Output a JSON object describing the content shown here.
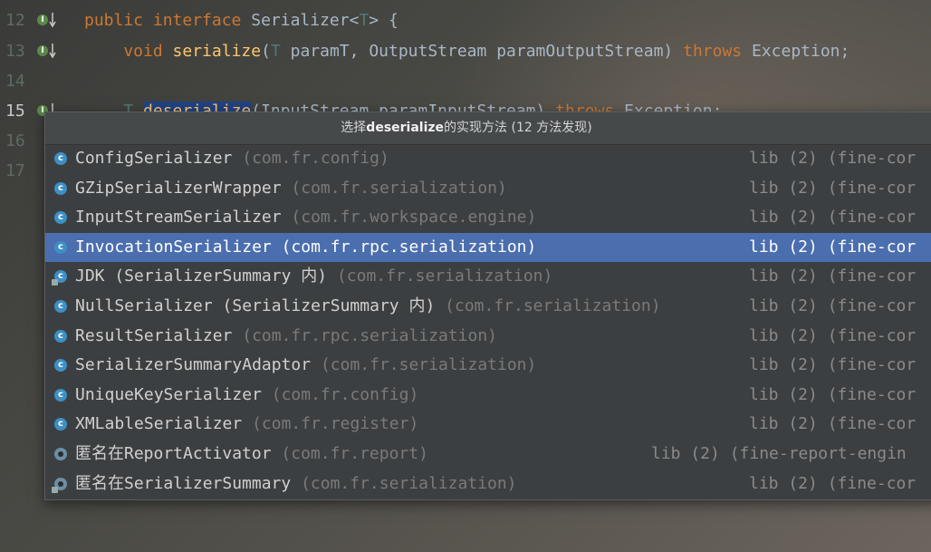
{
  "editor": {
    "lines": [
      {
        "number": "12",
        "code_parts": [
          {
            "t": "public ",
            "c": "kw"
          },
          {
            "t": "interface ",
            "c": "kw"
          },
          {
            "t": "Serializer<",
            "c": ""
          },
          {
            "t": "T",
            "c": "tp"
          },
          {
            "t": "> {",
            "c": ""
          }
        ]
      },
      {
        "number": "13",
        "code_parts": [
          {
            "t": "    void ",
            "c": "kw"
          },
          {
            "t": "serialize",
            "c": "fn"
          },
          {
            "t": "(",
            "c": ""
          },
          {
            "t": "T",
            "c": "tp"
          },
          {
            "t": " paramT, OutputStream paramOutputStream) ",
            "c": ""
          },
          {
            "t": "throws ",
            "c": "kw"
          },
          {
            "t": "Exception;",
            "c": ""
          }
        ]
      },
      {
        "number": "14",
        "code_parts": []
      },
      {
        "number": "15",
        "code_parts": [
          {
            "t": "    T ",
            "c": "tp"
          },
          {
            "t": "deserialize",
            "c": "fn hl"
          },
          {
            "t": "(InputStream paramInputStream) ",
            "c": ""
          },
          {
            "t": "throws ",
            "c": "kw"
          },
          {
            "t": "Exception;",
            "c": ""
          }
        ]
      },
      {
        "number": "16",
        "code_parts": []
      },
      {
        "number": "17",
        "code_parts": []
      }
    ]
  },
  "popup": {
    "title_prefix": "选择",
    "title_method": "deserialize",
    "title_suffix": "的实现方法 (12 方法发现)",
    "items": [
      {
        "name": "ConfigSerializer",
        "pkg": "(com.fr.config)",
        "lib": "lib (2) (fine-cor",
        "icon": "class-icon",
        "glyph": "c",
        "selected": false
      },
      {
        "name": "GZipSerializerWrapper",
        "pkg": "(com.fr.serialization)",
        "lib": "lib (2) (fine-cor",
        "icon": "class-icon",
        "glyph": "c",
        "selected": false
      },
      {
        "name": "InputStreamSerializer",
        "pkg": "(com.fr.workspace.engine)",
        "lib": "lib (2) (fine-cor",
        "icon": "class-icon",
        "glyph": "c",
        "selected": false
      },
      {
        "name": "InvocationSerializer",
        "pkg": "(com.fr.rpc.serialization)",
        "lib": "lib (2) (fine-cor",
        "icon": "class-icon",
        "glyph": "c",
        "selected": true
      },
      {
        "name": "JDK (SerializerSummary 内)",
        "pkg": "(com.fr.serialization)",
        "lib": "lib (2) (fine-cor",
        "icon": "inner-class-icon",
        "glyph": "c",
        "selected": false
      },
      {
        "name": "NullSerializer (SerializerSummary 内)",
        "pkg": "(com.fr.serialization)",
        "lib": "lib (2) (fine-cor",
        "icon": "class-icon",
        "glyph": "c",
        "selected": false
      },
      {
        "name": "ResultSerializer",
        "pkg": "(com.fr.rpc.serialization)",
        "lib": "lib (2) (fine-cor",
        "icon": "class-icon",
        "glyph": "c",
        "selected": false
      },
      {
        "name": "SerializerSummaryAdaptor",
        "pkg": "(com.fr.serialization)",
        "lib": "lib (2) (fine-cor",
        "icon": "class-icon",
        "glyph": "c",
        "selected": false
      },
      {
        "name": "UniqueKeySerializer",
        "pkg": "(com.fr.config)",
        "lib": "lib (2) (fine-cor",
        "icon": "class-icon",
        "glyph": "c",
        "selected": false
      },
      {
        "name": "XMLableSerializer",
        "pkg": "(com.fr.register)",
        "lib": "lib (2) (fine-cor",
        "icon": "class-icon",
        "glyph": "c",
        "selected": false
      },
      {
        "name": "匿名在ReportActivator",
        "pkg": "(com.fr.report)",
        "lib": "lib (2) (fine-report-engin",
        "icon": "anonymous-class-icon",
        "glyph": "",
        "selected": false
      },
      {
        "name": "匿名在SerializerSummary",
        "pkg": "(com.fr.serialization)",
        "lib": "lib (2) (fine-cor",
        "icon": "anonymous-class-icon",
        "glyph": "",
        "selected": false
      }
    ]
  },
  "colors": {
    "selection": "#4b6eaf",
    "class_icon": "#3d8fc5",
    "keyword": "#cc7832",
    "function": "#ffc66d"
  }
}
